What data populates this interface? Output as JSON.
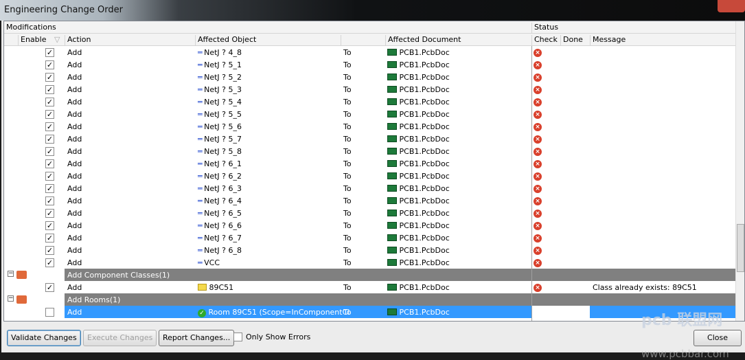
{
  "window": {
    "title": "Engineering Change Order"
  },
  "headers": {
    "modifications": "Modifications",
    "status": "Status",
    "enable": "Enable",
    "action": "Action",
    "affected_object": "Affected Object",
    "affected_document": "Affected Document",
    "check": "Check",
    "done": "Done",
    "message": "Message"
  },
  "rows": [
    {
      "enabled": true,
      "action": "Add",
      "object": "NetJ ? 4_8",
      "to": "To",
      "document": "PCB1.PcbDoc",
      "check": "error"
    },
    {
      "enabled": true,
      "action": "Add",
      "object": "NetJ ? 5_1",
      "to": "To",
      "document": "PCB1.PcbDoc",
      "check": "error"
    },
    {
      "enabled": true,
      "action": "Add",
      "object": "NetJ ? 5_2",
      "to": "To",
      "document": "PCB1.PcbDoc",
      "check": "error"
    },
    {
      "enabled": true,
      "action": "Add",
      "object": "NetJ ? 5_3",
      "to": "To",
      "document": "PCB1.PcbDoc",
      "check": "error"
    },
    {
      "enabled": true,
      "action": "Add",
      "object": "NetJ ? 5_4",
      "to": "To",
      "document": "PCB1.PcbDoc",
      "check": "error"
    },
    {
      "enabled": true,
      "action": "Add",
      "object": "NetJ ? 5_5",
      "to": "To",
      "document": "PCB1.PcbDoc",
      "check": "error"
    },
    {
      "enabled": true,
      "action": "Add",
      "object": "NetJ ? 5_6",
      "to": "To",
      "document": "PCB1.PcbDoc",
      "check": "error"
    },
    {
      "enabled": true,
      "action": "Add",
      "object": "NetJ ? 5_7",
      "to": "To",
      "document": "PCB1.PcbDoc",
      "check": "error"
    },
    {
      "enabled": true,
      "action": "Add",
      "object": "NetJ ? 5_8",
      "to": "To",
      "document": "PCB1.PcbDoc",
      "check": "error"
    },
    {
      "enabled": true,
      "action": "Add",
      "object": "NetJ ? 6_1",
      "to": "To",
      "document": "PCB1.PcbDoc",
      "check": "error"
    },
    {
      "enabled": true,
      "action": "Add",
      "object": "NetJ ? 6_2",
      "to": "To",
      "document": "PCB1.PcbDoc",
      "check": "error"
    },
    {
      "enabled": true,
      "action": "Add",
      "object": "NetJ ? 6_3",
      "to": "To",
      "document": "PCB1.PcbDoc",
      "check": "error"
    },
    {
      "enabled": true,
      "action": "Add",
      "object": "NetJ ? 6_4",
      "to": "To",
      "document": "PCB1.PcbDoc",
      "check": "error"
    },
    {
      "enabled": true,
      "action": "Add",
      "object": "NetJ ? 6_5",
      "to": "To",
      "document": "PCB1.PcbDoc",
      "check": "error"
    },
    {
      "enabled": true,
      "action": "Add",
      "object": "NetJ ? 6_6",
      "to": "To",
      "document": "PCB1.PcbDoc",
      "check": "error"
    },
    {
      "enabled": true,
      "action": "Add",
      "object": "NetJ ? 6_7",
      "to": "To",
      "document": "PCB1.PcbDoc",
      "check": "error"
    },
    {
      "enabled": true,
      "action": "Add",
      "object": "NetJ ? 6_8",
      "to": "To",
      "document": "PCB1.PcbDoc",
      "check": "error"
    },
    {
      "enabled": true,
      "action": "Add",
      "object": "VCC",
      "to": "To",
      "document": "PCB1.PcbDoc",
      "check": "error"
    }
  ],
  "groups": [
    {
      "label": "Add Component Classes(1)",
      "row": {
        "enabled": true,
        "action": "Add",
        "object": "89C51",
        "to": "To",
        "document": "PCB1.PcbDoc",
        "check": "error",
        "message": "Class already exists: 89C51"
      }
    },
    {
      "label": "Add Rooms(1)",
      "row": {
        "enabled": false,
        "action": "Add",
        "object": "Room 89C51 (Scope=InComponentCl",
        "to": "To",
        "document": "PCB1.PcbDoc",
        "selected": true
      }
    }
  ],
  "buttons": {
    "validate": "Validate Changes",
    "execute": "Execute Changes",
    "report": "Report Changes...",
    "only_errors": "Only Show Errors",
    "close": "Close"
  },
  "watermark": {
    "logo": "pcb 联盟网",
    "url": "www.pcbbar.com"
  },
  "colors": {
    "selection": "#3399ff",
    "group_bar": "#808080",
    "error": "#d9402c"
  }
}
